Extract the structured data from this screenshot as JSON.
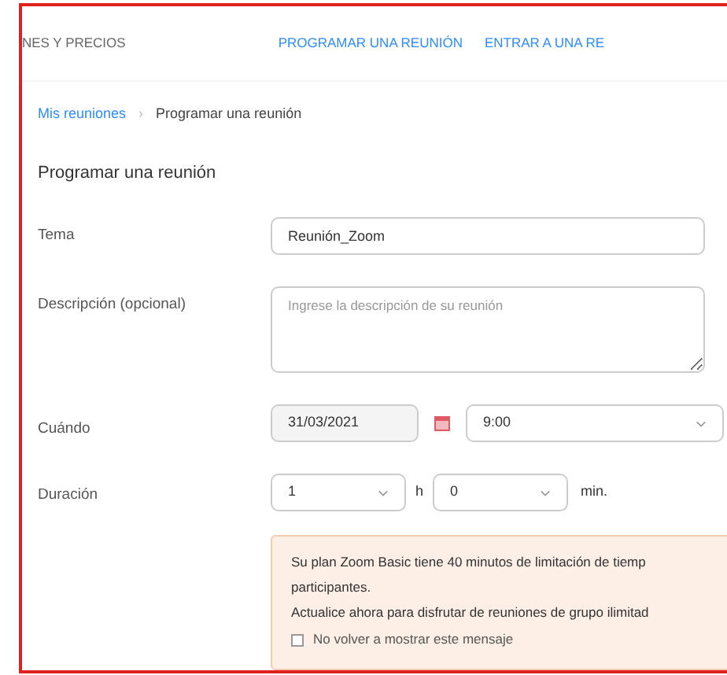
{
  "top_nav": {
    "left_item": "NES Y PRECIOS",
    "links": [
      "PROGRAMAR UNA REUNIÓN",
      "ENTRAR A UNA RE"
    ]
  },
  "breadcrumb": [
    {
      "label": "Mis reuniones",
      "link": true
    },
    {
      "label": "Programar una reunión",
      "link": false
    }
  ],
  "breadcrumb_separator": "›",
  "heading": "Programar una reunión",
  "form": {
    "topic": {
      "label": "Tema",
      "value": "Reunión_Zoom"
    },
    "description": {
      "label": "Descripción (opcional)",
      "placeholder": "Ingrese la descripción de su reunión"
    },
    "when": {
      "label": "Cuándo",
      "date": "31/03/2021",
      "time": "9:00"
    },
    "duration": {
      "label": "Duración",
      "hours": "1",
      "hours_unit": "h",
      "minutes": "0",
      "minutes_unit": "min."
    }
  },
  "notice": {
    "lines": [
      "Su plan Zoom Basic tiene 40 minutos de limitación de tiemp",
      "participantes.",
      "Actualice ahora para disfrutar de reuniones de grupo ilimitad"
    ],
    "checkbox": {
      "label": "No volver a mostrar este mensaje",
      "checked": false
    }
  }
}
